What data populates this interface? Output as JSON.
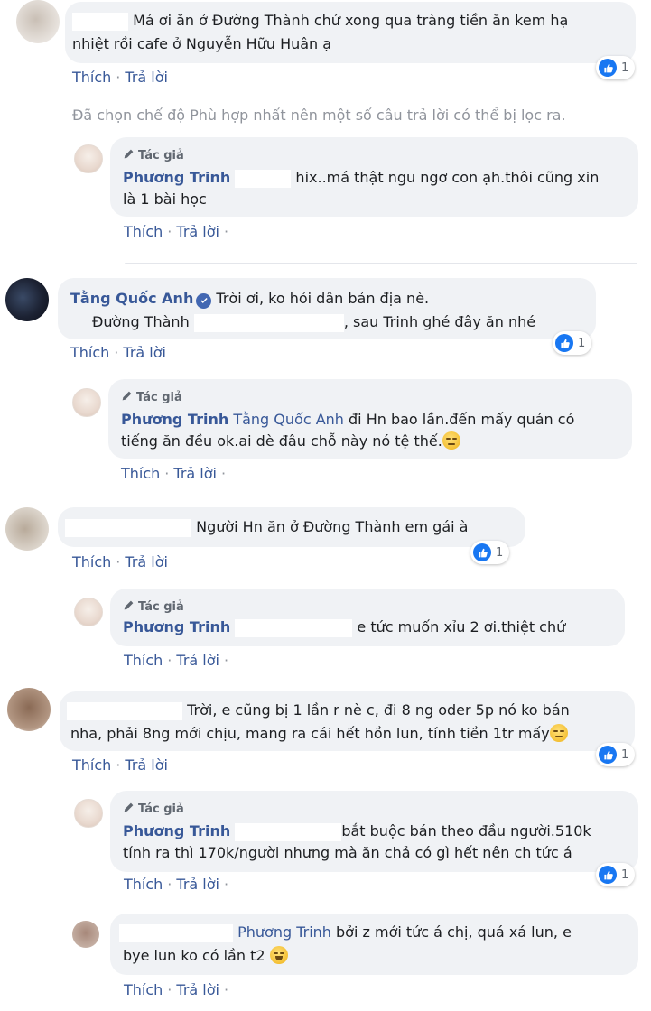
{
  "actions": {
    "like": "Thích",
    "reply": "Trả lời"
  },
  "author_tag": "Tác giả",
  "notice": "Đã chọn chế độ Phù hợp nhất nên một số câu trả lời có thể bị lọc ra.",
  "comments": [
    {
      "line1": "Má ơi ăn ở Đường Thành chứ xong qua tràng tiền ăn kem hạ",
      "line2": "nhiệt rồi cafe ở Nguyễn Hữu Huân ạ",
      "reactions": "1"
    },
    {
      "name": "Phương Trinh",
      "line1": "hix..má thật ngu ngơ con ạh.thôi cũng xin",
      "line2": "là 1 bài học"
    },
    {
      "name": "Tằng Quốc Anh",
      "line1": "Trời ơi, ko hỏi dân bản địa nè.",
      "line2a": "Đường Thành",
      "line2b": ", sau Trinh ghé đây ăn nhé",
      "reactions": "1"
    },
    {
      "name": "Phương Trinh",
      "mention": "Tằng Quốc Anh",
      "line1": "đi Hn bao lần.đến mấy quán có",
      "line2": "tiếng ăn đều ok.ai dè đâu chỗ này nó tệ thế."
    },
    {
      "line1": "Người Hn ăn ở Đường Thành em gái à",
      "reactions": "1"
    },
    {
      "name": "Phương Trinh",
      "line1": "e tức muốn xỉu 2 ơi.thiệt chứ"
    },
    {
      "line1": "Trời, e cũng bị 1 lần r nè c, đi 8 ng oder 5p nó ko bán",
      "line2": "nha, phải 8ng mới chịu, mang ra cái hết hồn lun, tính tiền 1tr mấy",
      "reactions": "1"
    },
    {
      "name": "Phương Trinh",
      "line1": "bắt buộc bán theo đầu người.510k",
      "line2": "tính ra thì 170k/người nhưng mà ăn chả có gì hết nên ch tức á",
      "reactions": "1"
    },
    {
      "mention": "Phương Trinh",
      "line1": "bởi z mới tức á chị, quá xá lun, e",
      "line2": "bye lun ko có lần t2"
    }
  ]
}
